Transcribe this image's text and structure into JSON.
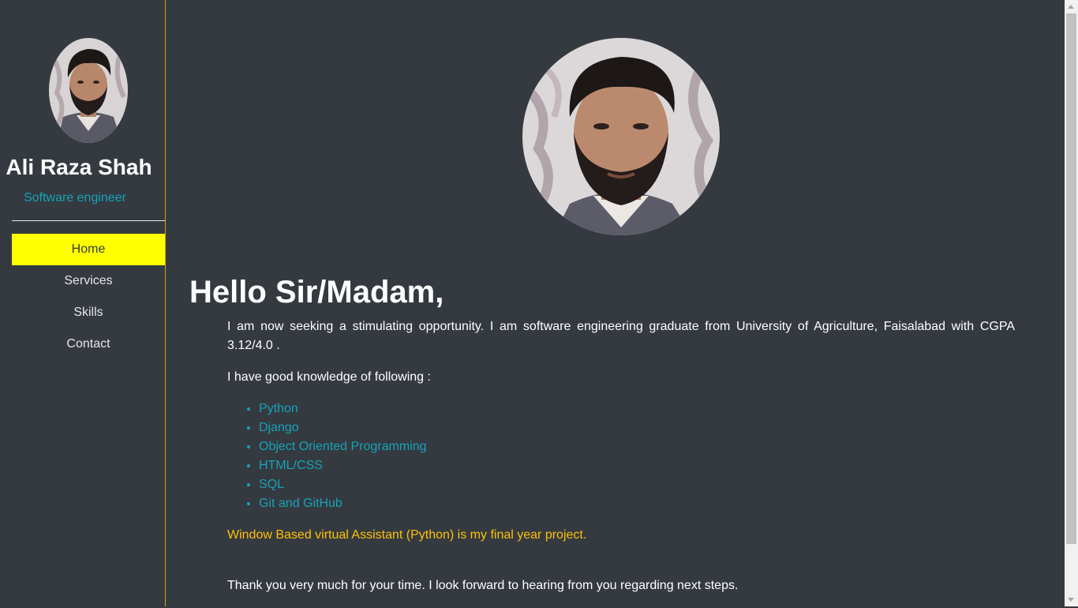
{
  "sidebar": {
    "name": "Ali Raza Shah",
    "role": "Software engineer",
    "nav": [
      {
        "label": "Home",
        "active": true
      },
      {
        "label": "Services",
        "active": false
      },
      {
        "label": "Skills",
        "active": false
      },
      {
        "label": "Contact",
        "active": false
      }
    ]
  },
  "main": {
    "greeting": "Hello Sir/Madam,",
    "intro": "I am now seeking a stimulating opportunity. I am software engineering graduate from University of Agriculture, Faisalabad with CGPA 3.12/4.0 .",
    "knowledge_heading": "I have good knowledge of following :",
    "skills": [
      "Python",
      "Django",
      "Object Oriented Programming",
      "HTML/CSS",
      "SQL",
      "Git and GitHub"
    ],
    "project": "Window Based virtual Assistant (Python) is my final year project.",
    "thanks": "Thank you very much for your time. I look forward to hearing from you regarding next steps."
  },
  "colors": {
    "background": "#343a40",
    "accent": "#ffff00",
    "link": "#17a2b8",
    "highlight": "#ffc107",
    "sidebar_border": "#d4a017"
  }
}
